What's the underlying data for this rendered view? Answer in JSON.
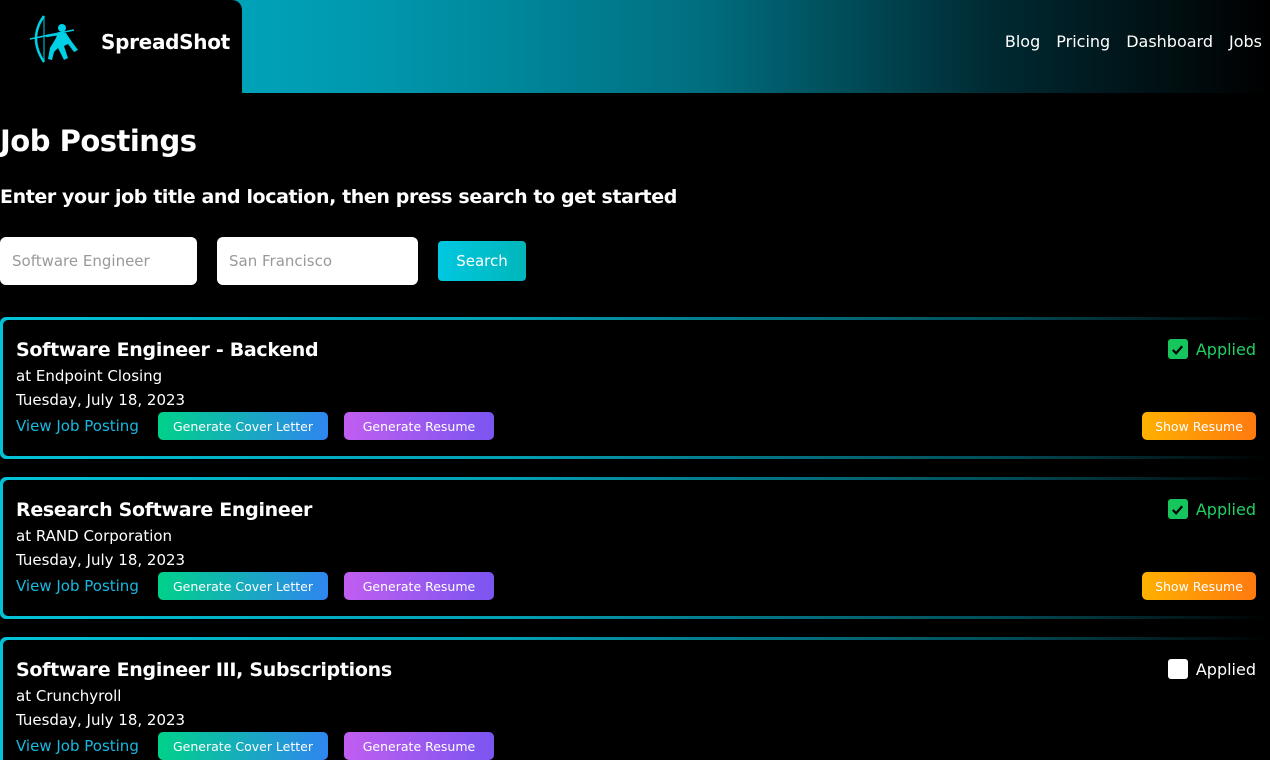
{
  "header": {
    "brand": "SpreadShot",
    "nav": [
      "Blog",
      "Pricing",
      "Dashboard",
      "Jobs"
    ]
  },
  "main": {
    "title": "Job Postings",
    "subtitle": "Enter your job title and location, then press search to get started",
    "search": {
      "title_placeholder": "Software Engineer",
      "location_placeholder": "San Francisco",
      "button_label": "Search"
    },
    "jobs": [
      {
        "title": "Software Engineer - Backend",
        "company": "at Endpoint Closing",
        "date": "Tuesday, July 18, 2023",
        "view_label": "View Job Posting",
        "cover_label": "Generate Cover Letter",
        "resume_label": "Generate Resume",
        "show_resume_label": "Show Resume",
        "applied_label": "Applied",
        "applied": true
      },
      {
        "title": "Research Software Engineer",
        "company": "at RAND Corporation",
        "date": "Tuesday, July 18, 2023",
        "view_label": "View Job Posting",
        "cover_label": "Generate Cover Letter",
        "resume_label": "Generate Resume",
        "show_resume_label": "Show Resume",
        "applied_label": "Applied",
        "applied": true
      },
      {
        "title": "Software Engineer III, Subscriptions",
        "company": "at Crunchyroll",
        "date": "Tuesday, July 18, 2023",
        "view_label": "View Job Posting",
        "cover_label": "Generate Cover Letter",
        "resume_label": "Generate Resume",
        "applied_label": "Applied",
        "applied": false
      }
    ]
  },
  "colors": {
    "accent": "#00c3d8",
    "applied_green": "#22d066",
    "link_blue": "#18b8e0"
  }
}
